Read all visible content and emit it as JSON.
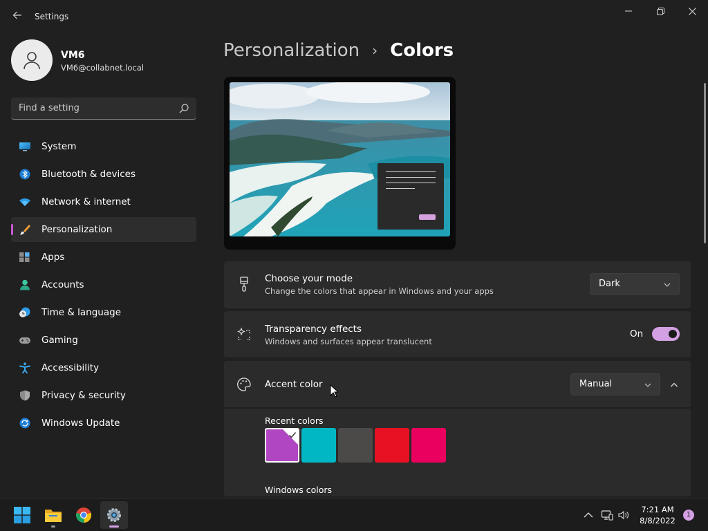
{
  "window": {
    "title": "Settings",
    "controls": [
      "minimize-icon",
      "restore-icon",
      "close-icon"
    ]
  },
  "profile": {
    "name": "VM6",
    "email": "VM6@collabnet.local"
  },
  "search": {
    "placeholder": "Find a setting"
  },
  "sidebar": {
    "items": [
      {
        "label": "System",
        "icon": "monitor-icon",
        "selected": false
      },
      {
        "label": "Bluetooth & devices",
        "icon": "bluetooth-icon",
        "selected": false
      },
      {
        "label": "Network & internet",
        "icon": "wifi-icon",
        "selected": false
      },
      {
        "label": "Personalization",
        "icon": "brush-icon",
        "selected": true
      },
      {
        "label": "Apps",
        "icon": "apps-icon",
        "selected": false
      },
      {
        "label": "Accounts",
        "icon": "person-icon",
        "selected": false
      },
      {
        "label": "Time & language",
        "icon": "clock-globe-icon",
        "selected": false
      },
      {
        "label": "Gaming",
        "icon": "gamepad-icon",
        "selected": false
      },
      {
        "label": "Accessibility",
        "icon": "accessibility-icon",
        "selected": false
      },
      {
        "label": "Privacy & security",
        "icon": "shield-icon",
        "selected": false
      },
      {
        "label": "Windows Update",
        "icon": "update-icon",
        "selected": false
      }
    ]
  },
  "breadcrumb": {
    "parent": "Personalization",
    "separator": "›",
    "current": "Colors"
  },
  "mode_card": {
    "title": "Choose your mode",
    "description": "Change the colors that appear in Windows and your apps",
    "value": "Dark"
  },
  "transparency_card": {
    "title": "Transparency effects",
    "description": "Windows and surfaces appear translucent",
    "state_label": "On",
    "enabled": true
  },
  "accent_card": {
    "title": "Accent color",
    "value": "Manual",
    "expanded": true,
    "recent_label": "Recent colors",
    "windows_label": "Windows colors",
    "recent_colors": [
      "#b146c2",
      "#00b7c3",
      "#4c4a48",
      "#e81123",
      "#ea005e"
    ],
    "selected_recent": 0,
    "windows_colors": [
      "#ffb900",
      "#ff8c00",
      "#f7630c",
      "#ca5010",
      "#da3b01",
      "#ef6950",
      "#d13438",
      "#ff4343",
      "#e74856"
    ]
  },
  "colors": {
    "accent": "#d4a0e4",
    "background": "#202020",
    "card": "#2b2b2b"
  },
  "taskbar": {
    "apps": [
      {
        "name": "start-icon"
      },
      {
        "name": "file-explorer-icon"
      },
      {
        "name": "chrome-icon"
      },
      {
        "name": "settings-icon",
        "active": true
      }
    ],
    "time": "7:21 AM",
    "date": "8/8/2022",
    "notification_count": "1"
  }
}
